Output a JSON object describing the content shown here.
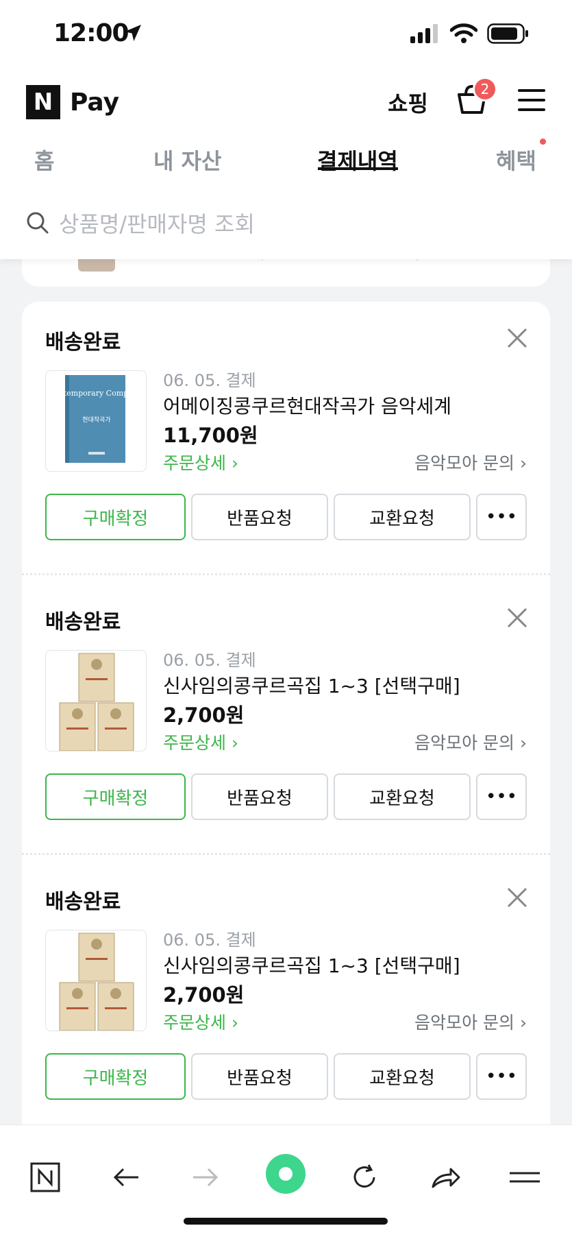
{
  "status_bar": {
    "time": "12:00"
  },
  "header": {
    "logo_letter": "N",
    "logo_text": "Pay",
    "shop_link": "쇼핑",
    "cart_badge": "2"
  },
  "tabs": [
    {
      "label": "홈",
      "active": false
    },
    {
      "label": "내 자산",
      "active": false
    },
    {
      "label": "결제내역",
      "active": true
    },
    {
      "label": "혜택",
      "active": false
    }
  ],
  "search": {
    "placeholder": "상품명/판매자명 조회"
  },
  "orders": [
    {
      "status": "배송완료",
      "date": "06. 05. 결제",
      "title": "어메이징콩쿠르현대작곡가 음악세계",
      "price": "11,700원",
      "detail_link": "주문상세",
      "seller_link": "음악모아 문의",
      "thumb_type": "blue-book",
      "thumb_title": "Contemporary Composer",
      "thumb_subtitle": "현대작곡가",
      "buttons": {
        "confirm": "구매확정",
        "return": "반품요청",
        "exchange": "교환요청"
      }
    },
    {
      "status": "배송완료",
      "date": "06. 05. 결제",
      "title": "신사임의콩쿠르곡집 1~3 [선택구매]",
      "price": "2,700원",
      "detail_link": "주문상세",
      "seller_link": "음악모아 문의",
      "thumb_type": "beige-books",
      "buttons": {
        "confirm": "구매확정",
        "return": "반품요청",
        "exchange": "교환요청"
      }
    },
    {
      "status": "배송완료",
      "date": "06. 05. 결제",
      "title": "신사임의콩쿠르곡집 1~3 [선택구매]",
      "price": "2,700원",
      "detail_link": "주문상세",
      "seller_link": "음악모아 문의",
      "thumb_type": "beige-books",
      "buttons": {
        "confirm": "구매확정",
        "return": "반품요청",
        "exchange": "교환요청"
      }
    }
  ],
  "colors": {
    "accent_green": "#3cb64a",
    "badge_red": "#f05a5a",
    "browser_dot": "#3dd68c"
  }
}
